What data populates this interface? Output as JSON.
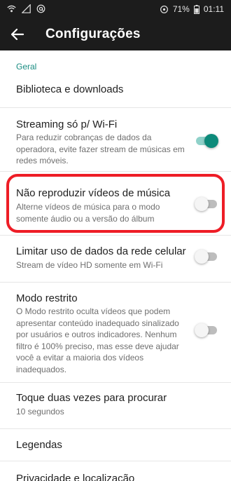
{
  "status_bar": {
    "battery": "71%",
    "time": "01:11",
    "icons": [
      "wifi-icon",
      "signal-icon",
      "at-icon",
      "sync-icon",
      "battery-icon"
    ]
  },
  "appbar": {
    "title": "Configurações",
    "back_icon": "arrow-back-icon"
  },
  "section_header": "Geral",
  "items": [
    {
      "title": "Biblioteca e downloads"
    },
    {
      "title": "Streaming só p/ Wi-Fi",
      "subtitle": "Para reduzir cobranças de dados da operadora, evite fazer stream de músicas em redes móveis.",
      "toggle": true
    },
    {
      "title": "Não reproduzir vídeos de música",
      "subtitle": "Alterne vídeos de música para o modo somente áudio ou a versão do álbum",
      "toggle": false
    },
    {
      "title": "Limitar uso de dados da rede celular",
      "subtitle": "Stream de vídeo HD somente em Wi-Fi",
      "toggle": false
    },
    {
      "title": "Modo restrito",
      "subtitle": "O Modo restrito oculta vídeos que podem apresentar conteúdo inadequado sinalizado por usuários e outros indicadores. Nenhum filtro é 100% preciso, mas esse deve ajudar você a evitar a maioria dos vídeos inadequados.",
      "toggle": false
    },
    {
      "title": "Toque duas vezes para procurar",
      "subtitle": "10 segundos"
    },
    {
      "title": "Legendas"
    },
    {
      "title": "Privacidade e localização"
    }
  ],
  "colors": {
    "accent": "#1a8d82",
    "toggle_on_thumb": "#0d8a7a",
    "toggle_on_track": "#8fd1c9",
    "highlight": "#ee1d26",
    "bar_background": "#1c1c1c"
  }
}
